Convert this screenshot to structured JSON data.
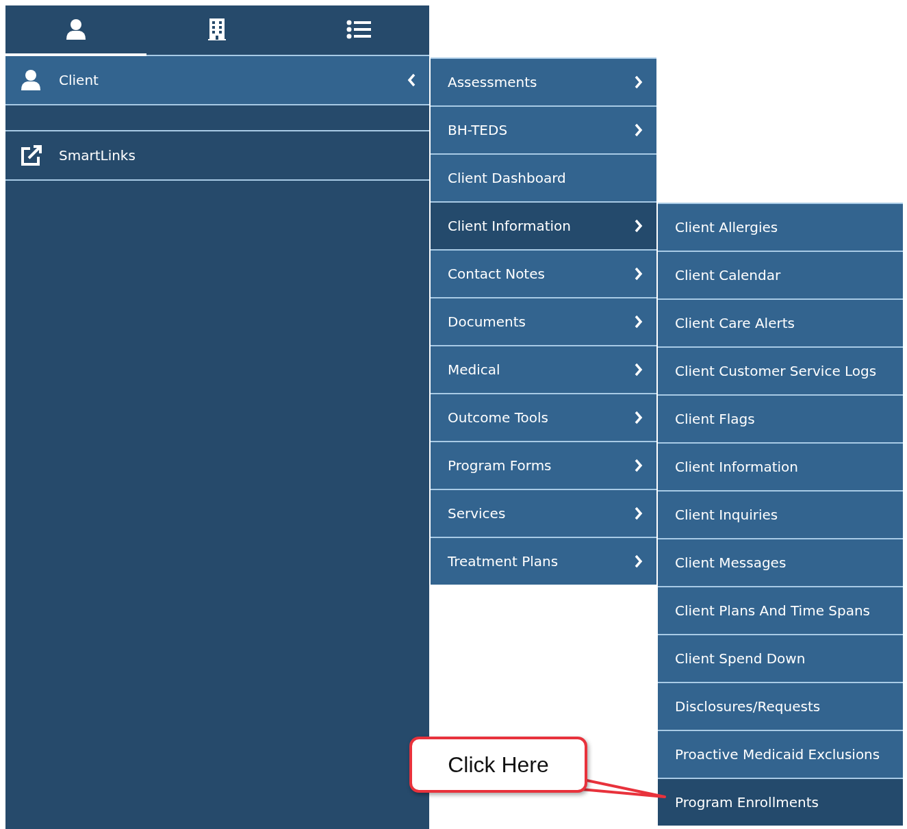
{
  "tabs": [
    {
      "kind": "client",
      "selected": true
    },
    {
      "kind": "organization",
      "selected": false
    },
    {
      "kind": "list",
      "selected": false
    }
  ],
  "sidebar": {
    "items": [
      {
        "kind": "client",
        "label": "Client",
        "expanded": true
      },
      {
        "kind": "link",
        "label": "SmartLinks",
        "expanded": false
      }
    ]
  },
  "menu": {
    "items": [
      {
        "label": "Assessments",
        "has_submenu": true,
        "selected": false
      },
      {
        "label": "BH-TEDS",
        "has_submenu": true,
        "selected": false
      },
      {
        "label": "Client Dashboard",
        "has_submenu": false,
        "selected": false
      },
      {
        "label": "Client Information",
        "has_submenu": true,
        "selected": true
      },
      {
        "label": "Contact Notes",
        "has_submenu": true,
        "selected": false
      },
      {
        "label": "Documents",
        "has_submenu": true,
        "selected": false
      },
      {
        "label": "Medical",
        "has_submenu": true,
        "selected": false
      },
      {
        "label": "Outcome Tools",
        "has_submenu": true,
        "selected": false
      },
      {
        "label": "Program Forms",
        "has_submenu": true,
        "selected": false
      },
      {
        "label": "Services",
        "has_submenu": true,
        "selected": false
      },
      {
        "label": "Treatment Plans",
        "has_submenu": true,
        "selected": false
      }
    ]
  },
  "submenu": {
    "items": [
      {
        "label": "Client Allergies",
        "selected": false
      },
      {
        "label": "Client Calendar",
        "selected": false
      },
      {
        "label": "Client Care Alerts",
        "selected": false
      },
      {
        "label": "Client Customer Service Logs",
        "selected": false
      },
      {
        "label": "Client Flags",
        "selected": false
      },
      {
        "label": "Client Information",
        "selected": false
      },
      {
        "label": "Client Inquiries",
        "selected": false
      },
      {
        "label": "Client Messages",
        "selected": false
      },
      {
        "label": "Client Plans And Time Spans",
        "selected": false
      },
      {
        "label": "Client Spend Down",
        "selected": false
      },
      {
        "label": "Disclosures/Requests",
        "selected": false
      },
      {
        "label": "Proactive Medicaid Exclusions",
        "selected": false
      },
      {
        "label": "Program Enrollments",
        "selected": true
      }
    ]
  },
  "callout": {
    "text": "Click Here"
  }
}
